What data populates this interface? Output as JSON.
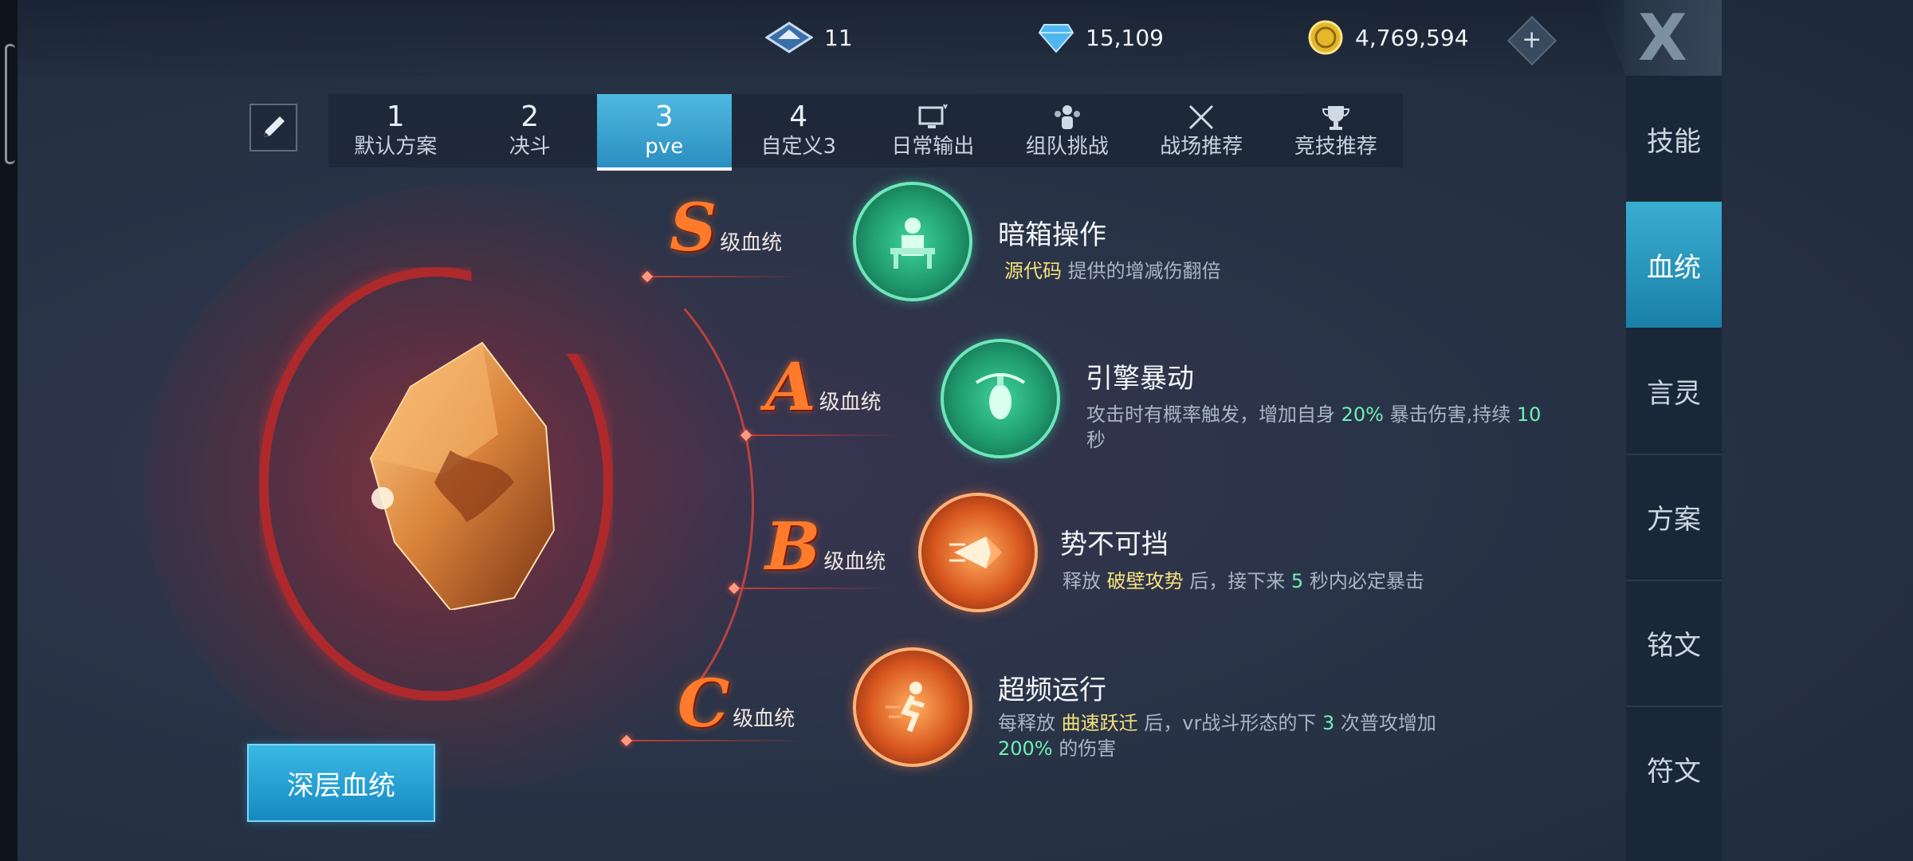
{
  "currencies": {
    "crystal_icon": "blue-crystal-icon",
    "crystal_value": "11",
    "diamond_icon": "diamond-icon",
    "diamond_value": "15,109",
    "coin_icon": "gold-coin-icon",
    "coin_value": "4,769,594",
    "plus_label": "+"
  },
  "close_label": "X",
  "tabs": [
    {
      "num": "1",
      "label": "默认方案"
    },
    {
      "num": "2",
      "label": "决斗"
    },
    {
      "num": "3",
      "label": "pve"
    },
    {
      "num": "4",
      "label": "自定义3"
    },
    {
      "icon": "monitor-icon",
      "label": "日常输出"
    },
    {
      "icon": "team-icon",
      "label": "组队挑战"
    },
    {
      "icon": "crossed-swords-icon",
      "label": "战场推荐"
    },
    {
      "icon": "trophy-icon",
      "label": "竞技推荐"
    }
  ],
  "active_tab_index": 2,
  "right_nav": [
    "技能",
    "血统",
    "言灵",
    "方案",
    "铭文",
    "符文"
  ],
  "active_nav_index": 1,
  "deep_button": "深层血统",
  "grades": [
    {
      "letter": "S",
      "text": "级血统"
    },
    {
      "letter": "A",
      "text": "级血统"
    },
    {
      "letter": "B",
      "text": "级血统"
    },
    {
      "letter": "C",
      "text": "级血统"
    }
  ],
  "skills": [
    {
      "title": "暗箱操作",
      "desc": [
        {
          "t": "源代码",
          "c": "y"
        },
        {
          "t": " 提供的增减伤翻倍",
          "c": ""
        }
      ]
    },
    {
      "title": "引擎暴动",
      "desc": [
        {
          "t": "攻击时有概率触发，增加自身 ",
          "c": ""
        },
        {
          "t": "20%",
          "c": "g"
        },
        {
          "t": " 暴击伤害,持续 ",
          "c": ""
        },
        {
          "t": "10",
          "c": "g"
        },
        {
          "t": " 秒",
          "c": ""
        }
      ]
    },
    {
      "title": "势不可挡",
      "desc": [
        {
          "t": "释放 ",
          "c": ""
        },
        {
          "t": "破壁攻势",
          "c": "y"
        },
        {
          "t": " 后，接下来 ",
          "c": ""
        },
        {
          "t": "5",
          "c": "g"
        },
        {
          "t": " 秒内必定暴击",
          "c": ""
        }
      ]
    },
    {
      "title": "超频运行",
      "desc": [
        {
          "t": "每释放 ",
          "c": ""
        },
        {
          "t": "曲速跃迁",
          "c": "y"
        },
        {
          "t": " 后，vr战斗形态的下 ",
          "c": ""
        },
        {
          "t": "3",
          "c": "g"
        },
        {
          "t": " 次普攻增加 ",
          "c": ""
        },
        {
          "t": "200%",
          "c": "g"
        },
        {
          "t": " 的伤害",
          "c": ""
        }
      ]
    }
  ],
  "colors": {
    "accent": "#2b8ec0",
    "highlight_yellow": "#f7e27c",
    "highlight_green": "#6ff0b6",
    "grade_orange": "#ff7a2a"
  }
}
